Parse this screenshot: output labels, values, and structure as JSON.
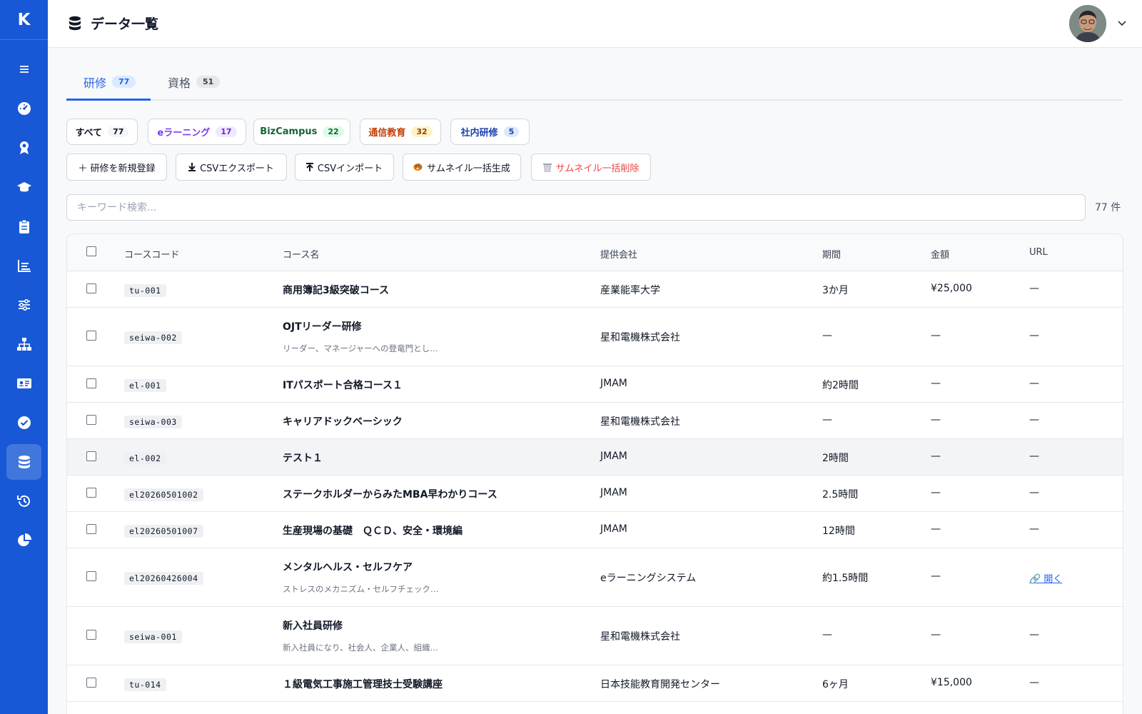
{
  "app": {
    "logo": "K"
  },
  "header": {
    "title": "データ一覧"
  },
  "sidebar": {
    "items": [
      {
        "icon": "menu-icon"
      },
      {
        "icon": "dashboard-icon"
      },
      {
        "icon": "award-icon"
      },
      {
        "icon": "graduation-cap-icon"
      },
      {
        "icon": "clipboard-icon"
      },
      {
        "icon": "bar-chart-icon"
      },
      {
        "icon": "sliders-icon"
      },
      {
        "icon": "org-chart-icon"
      },
      {
        "icon": "id-card-icon"
      },
      {
        "icon": "check-circle-icon"
      },
      {
        "icon": "database-icon",
        "active": true
      },
      {
        "icon": "history-icon"
      },
      {
        "icon": "pie-chart-icon"
      }
    ]
  },
  "tabs": [
    {
      "label": "研修",
      "count": "77",
      "active": true
    },
    {
      "label": "資格",
      "count": "51",
      "active": false
    }
  ],
  "filters": [
    {
      "label": "すべて",
      "count": "77",
      "color": "#111827",
      "badge_bg": "#f3f4f6",
      "badge_color": "#111827"
    },
    {
      "label": "eラーニング",
      "count": "17",
      "color": "#7c3aed",
      "badge_bg": "#ede9fe",
      "badge_color": "#6d28d9"
    },
    {
      "label": "BizCampus",
      "count": "22",
      "color": "#166534",
      "badge_bg": "#dcfce7",
      "badge_color": "#166534"
    },
    {
      "label": "通信教育",
      "count": "32",
      "color": "#c2410c",
      "badge_bg": "#fef3c7",
      "badge_color": "#92400e"
    },
    {
      "label": "社内研修",
      "count": "5",
      "color": "#1e40af",
      "badge_bg": "#dbeafe",
      "badge_color": "#1e40af"
    }
  ],
  "actions": [
    {
      "label": "＋ 研修を新規登録",
      "icon": ""
    },
    {
      "label": "CSVエクスポート",
      "icon": "download-arrow-icon"
    },
    {
      "label": "CSVインポート",
      "icon": "upload-arrow-icon"
    },
    {
      "label": "サムネイル一括生成",
      "icon": "palette-icon"
    },
    {
      "label": "サムネイル一括削除",
      "icon": "trash-icon",
      "danger": true
    }
  ],
  "search": {
    "placeholder": "キーワード検索...",
    "value": ""
  },
  "result_count": "77 件",
  "table": {
    "columns": [
      "コースコード",
      "コース名",
      "提供会社",
      "期間",
      "金額",
      "URL"
    ],
    "rows": [
      {
        "code": "tu-001",
        "name": "商用簿記3級突破コース",
        "desc": "",
        "company": "産業能率大学",
        "period": "3か月",
        "price": "¥25,000",
        "url": "—"
      },
      {
        "code": "seiwa-002",
        "name": "OJTリーダー研修",
        "desc": "リーダー、マネージャーへの登竜門とし…",
        "company": "星和電機株式会社",
        "period": "—",
        "price": "—",
        "url": "—"
      },
      {
        "code": "el-001",
        "name": "ITパスポート合格コース１",
        "desc": "",
        "company": "JMAM",
        "period": "約2時間",
        "price": "—",
        "url": "—"
      },
      {
        "code": "seiwa-003",
        "name": "キャリアドックベーシック",
        "desc": "",
        "company": "星和電機株式会社",
        "period": "—",
        "price": "—",
        "url": "—"
      },
      {
        "code": "el-002",
        "name": "テスト１",
        "desc": "",
        "company": "JMAM",
        "period": "2時間",
        "price": "—",
        "url": "—",
        "highlight": true
      },
      {
        "code": "el20260501002",
        "name": "ステークホルダーからみたMBA早わかりコース",
        "desc": "",
        "company": "JMAM",
        "period": "2.5時間",
        "price": "—",
        "url": "—"
      },
      {
        "code": "el20260501007",
        "name": "生産現場の基礎　ＱＣＤ、安全・環境編",
        "desc": "",
        "company": "JMAM",
        "period": "12時間",
        "price": "—",
        "url": "—"
      },
      {
        "code": "el20260426004",
        "name": "メンタルヘルス・セルフケア",
        "desc": "ストレスのメカニズム・セルフチェック…",
        "company": "eラーニングシステム",
        "period": "約1.5時間",
        "price": "—",
        "url": "🔗 開く",
        "is_link": true
      },
      {
        "code": "seiwa-001",
        "name": "新入社員研修",
        "desc": "新入社員になり、社会人、企業人、組織…",
        "company": "星和電機株式会社",
        "period": "—",
        "price": "—",
        "url": "—"
      },
      {
        "code": "tu-014",
        "name": "１級電気工事施工管理技士受験講座",
        "desc": "",
        "company": "日本技能教育開発センター",
        "period": "6ヶ月",
        "price": "¥15,000",
        "url": "—"
      }
    ]
  },
  "colors": {
    "sidebar": "#1858d6",
    "accent": "#2563eb",
    "danger": "#ef4444"
  }
}
